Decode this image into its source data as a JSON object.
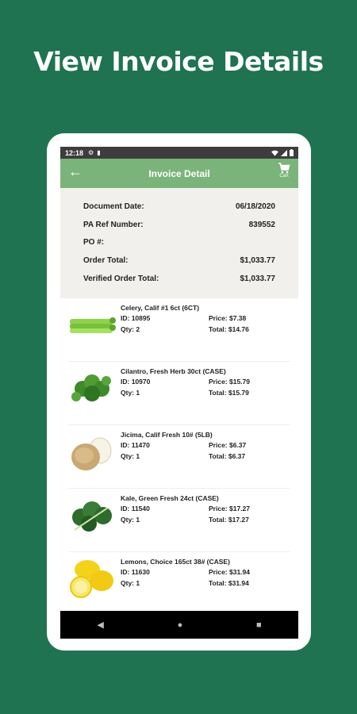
{
  "headline": "View Invoice Details",
  "status_bar": {
    "time": "12:18"
  },
  "app_bar": {
    "title": "Invoice Detail",
    "cart_label": "Cart"
  },
  "summary": [
    {
      "label": "Document Date:",
      "value": "06/18/2020"
    },
    {
      "label": "PA Ref Number:",
      "value": "839552"
    },
    {
      "label": "PO #:",
      "value": ""
    },
    {
      "label": "Order Total:",
      "value": "$1,033.77"
    },
    {
      "label": "Verified Order Total:",
      "value": "$1,033.77"
    }
  ],
  "items": [
    {
      "name": "Celery, Calif #1  6ct (6CT)",
      "id": "ID: 10895",
      "price": "Price: $7.38",
      "qty": "Qty: 2",
      "total": "Total: $14.76"
    },
    {
      "name": "Cilantro, Fresh Herb 30ct (CASE)",
      "id": "ID: 10970",
      "price": "Price: $15.79",
      "qty": "Qty: 1",
      "total": "Total: $15.79"
    },
    {
      "name": "Jicima, Calif Fresh 10# (5LB)",
      "id": "ID: 11470",
      "price": "Price: $6.37",
      "qty": "Qty: 1",
      "total": "Total: $6.37"
    },
    {
      "name": "Kale, Green Fresh 24ct (CASE)",
      "id": "ID: 11540",
      "price": "Price: $17.27",
      "qty": "Qty: 1",
      "total": "Total: $17.27"
    },
    {
      "name": "Lemons, Choice 165ct  38# (CASE)",
      "id": "ID: 11630",
      "price": "Price: $31.94",
      "qty": "Qty: 1",
      "total": "Total: $31.94"
    }
  ],
  "colors": {
    "background": "#1f7350",
    "app_bar": "#7bb47a",
    "summary_bg": "#f1f0ec"
  }
}
